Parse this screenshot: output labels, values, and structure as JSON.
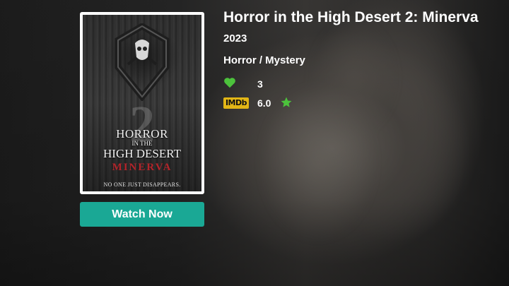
{
  "movie": {
    "title": "Horror in the High Desert 2: Minerva",
    "year": "2023",
    "genre": "Horror / Mystery",
    "likes": "3",
    "imdb_label": "IMDb",
    "imdb_rating": "6.0"
  },
  "poster": {
    "number": "2",
    "title_line1": "HORROR",
    "title_line2": "IN THE",
    "title_line3": "HIGH DESERT",
    "subtitle": "MINERVA",
    "tagline": "NO ONE JUST DISAPPEARS."
  },
  "actions": {
    "watch_label": "Watch Now"
  },
  "icons": {
    "like": "heart-icon",
    "rating": "star-icon"
  },
  "colors": {
    "accent": "#1aa895",
    "heart": "#4cc23c",
    "star": "#4cc23c",
    "imdb": "#e2b616"
  }
}
